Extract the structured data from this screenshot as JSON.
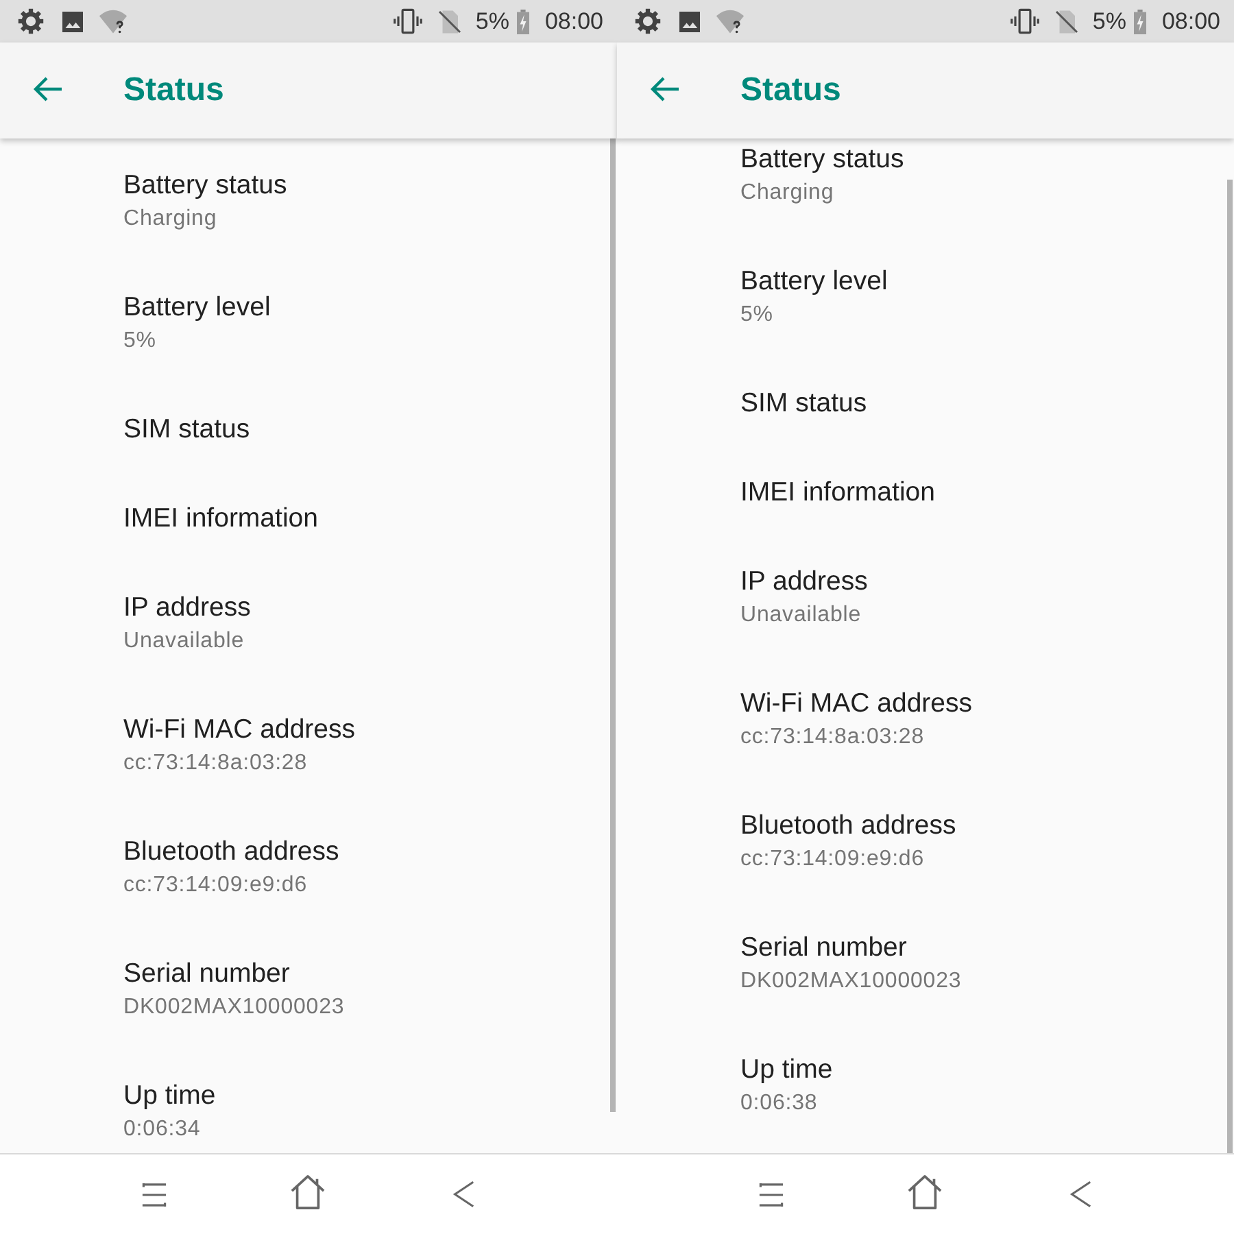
{
  "screens": [
    {
      "status_bar": {
        "battery": "5%",
        "time": "08:00"
      },
      "app_bar": {
        "title": "Status"
      },
      "scrolled_to_end": false,
      "items": [
        {
          "title": "Battery status",
          "value": "Charging"
        },
        {
          "title": "Battery level",
          "value": "5%"
        },
        {
          "title": "SIM status"
        },
        {
          "title": "IMEI information"
        },
        {
          "title": "IP address",
          "value": "Unavailable"
        },
        {
          "title": "Wi-Fi MAC address",
          "value": "cc:73:14:8a:03:28"
        },
        {
          "title": "Bluetooth address",
          "value": "cc:73:14:09:e9:d6"
        },
        {
          "title": "Serial number",
          "value": "DK002MAX10000023"
        },
        {
          "title": "Up time",
          "value": "0:06:34"
        }
      ]
    },
    {
      "status_bar": {
        "battery": "5%",
        "time": "08:00"
      },
      "app_bar": {
        "title": "Status"
      },
      "scrolled_to_end": true,
      "items": [
        {
          "title": "Battery status",
          "value": "Charging"
        },
        {
          "title": "Battery level",
          "value": "5%"
        },
        {
          "title": "SIM status"
        },
        {
          "title": "IMEI information"
        },
        {
          "title": "IP address",
          "value": "Unavailable"
        },
        {
          "title": "Wi-Fi MAC address",
          "value": "cc:73:14:8a:03:28"
        },
        {
          "title": "Bluetooth address",
          "value": "cc:73:14:09:e9:d6"
        },
        {
          "title": "Serial number",
          "value": "DK002MAX10000023"
        },
        {
          "title": "Up time",
          "value": "0:06:38"
        }
      ]
    }
  ]
}
